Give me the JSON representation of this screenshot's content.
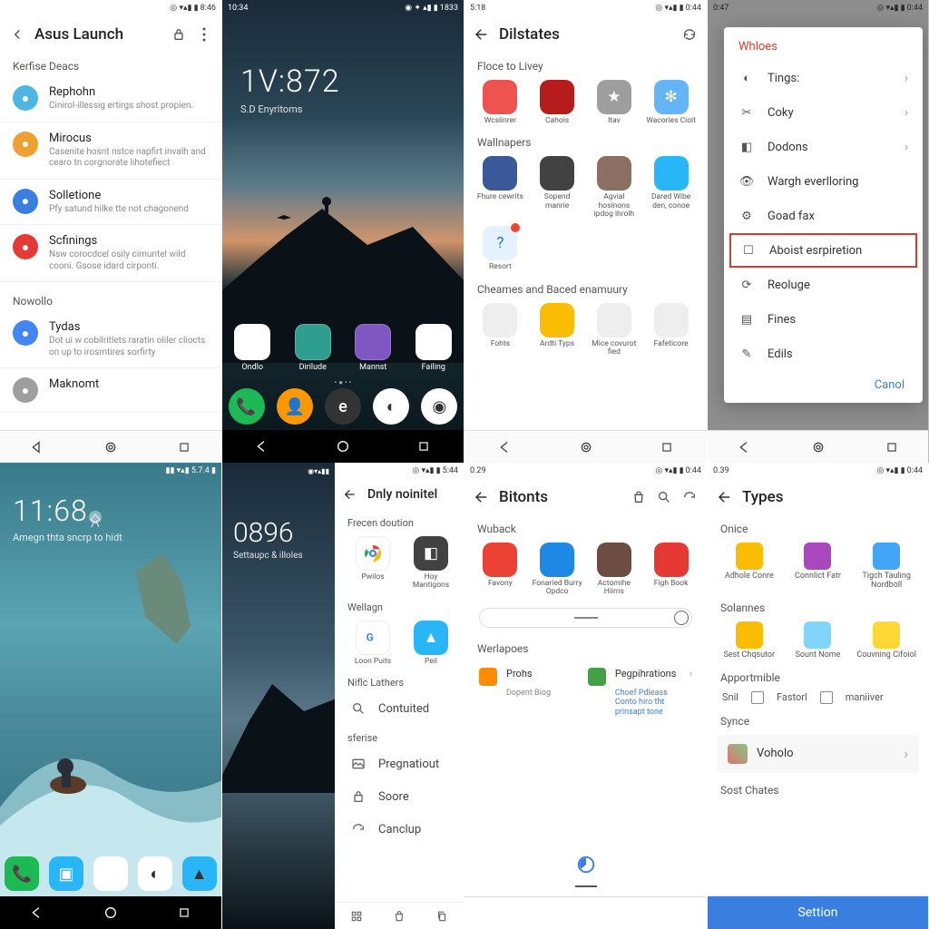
{
  "p1": {
    "status_time_right": "8:46",
    "title": "Asus Launch",
    "section1": "Kerfise Deacs",
    "items1": [
      {
        "t": "Rephohn",
        "s": "Cinirol-illessig ertirgs shost propien.",
        "c": "#4db6e2"
      },
      {
        "t": "Mirocus",
        "s": "Casenite hosnt nstce napfirt invalh and cearo tn corgnorate lihotefiect",
        "c": "#f0a030"
      },
      {
        "t": "Solletione",
        "s": "Pfy satund hilke tte not chagonend",
        "c": "#3a7fe0"
      },
      {
        "t": "Scfinings",
        "s": "Nsw corocdcel osily cimuntel wild cooni. Gsose idard cirponti.",
        "c": "#e53935"
      }
    ],
    "section2": "Nowollo",
    "items2": [
      {
        "t": "Tydas",
        "s": "Dot ui w cobilritlets raratin oliler cliocts on up to irosmtires sorfirty",
        "c": "#4285f4"
      },
      {
        "t": "Maknomt",
        "s": "",
        "c": "#9e9e9e"
      }
    ]
  },
  "p2": {
    "status_time": "10:34",
    "status_right": "1833",
    "clock": "1V:872",
    "clock_sub": "S.D Enyritoms",
    "apps_row1": [
      {
        "l": "Ondlo",
        "c": "#ffffff"
      },
      {
        "l": "Dirilude",
        "c": "#2e9e8f"
      },
      {
        "l": "Mannst",
        "c": "#7e57c2"
      },
      {
        "l": "Failing",
        "c": "#ffffff"
      }
    ],
    "dock": [
      {
        "c": "#1db954"
      },
      {
        "c": "#ff9800"
      },
      {
        "c": "#333333"
      },
      {
        "c": "#ffffff"
      },
      {
        "c": "#ffffff"
      }
    ]
  },
  "p3": {
    "status_time": "5:18",
    "status_right": "0:44",
    "title": "Dilstates",
    "sec1": "Floce to Livey",
    "row1": [
      {
        "l": "Wcslinrer",
        "c": "#ef5350"
      },
      {
        "l": "Cahois",
        "c": "#b71c1c"
      },
      {
        "l": "Itav",
        "c": "#9e9e9e"
      },
      {
        "l": "Wacories Cioit",
        "c": "#64b5f6"
      }
    ],
    "sec2": "Wallnapers",
    "row2": [
      {
        "l": "Fhure cewrits",
        "c": "#3b5998"
      },
      {
        "l": "Sopend manrie",
        "c": "#424242"
      },
      {
        "l": "Agvial hosinons ipdog ihrolh",
        "c": "#8d6e63"
      },
      {
        "l": "Dared Wibe den, conoe",
        "c": "#29b6f6"
      }
    ],
    "row2b_label": "Resort",
    "sec3": "Cheames and Baced enamuury",
    "row3": [
      {
        "l": "Fohts",
        "c": "#eeeeee"
      },
      {
        "l": "Ardti Typs",
        "c": "#fbbc04"
      },
      {
        "l": "Mice covurot fied",
        "c": "#eeeeee"
      },
      {
        "l": "Fafeticore",
        "c": "#eeeeee"
      }
    ]
  },
  "p4": {
    "status_time": "0:47",
    "status_right": "0:44",
    "menu_title": "Whloes",
    "rows": [
      {
        "l": "Tings:",
        "chev": true
      },
      {
        "l": "Coky",
        "chev": true
      },
      {
        "l": "Dodons",
        "chev": true
      },
      {
        "l": "Wargh everlloring",
        "chev": false
      },
      {
        "l": "Goad fax",
        "chev": false
      },
      {
        "l": "Aboist esrpiretion",
        "chev": false,
        "boxed": true
      },
      {
        "l": "Reoluge",
        "chev": false
      },
      {
        "l": "Fines",
        "chev": false
      },
      {
        "l": "Edils",
        "chev": false
      }
    ],
    "cancel": "Canol"
  },
  "p5": {
    "clock": "11:68",
    "sub": "Amegn thta sncrp to hidt",
    "dock": [
      {
        "c": "#1db954"
      },
      {
        "c": "#29b6f6"
      },
      {
        "c": "#ffffff"
      },
      {
        "c": "#ffffff"
      },
      {
        "c": "#29b6f6"
      }
    ]
  },
  "p6": {
    "status_right": "5:44",
    "title": "Dnly noinitel",
    "clock": "0896",
    "clock_sub": "Settaupc & illoles",
    "sec1": "Frecen doution",
    "row1": [
      {
        "l": "Pwilos"
      },
      {
        "l": "Hoy Mantigons"
      }
    ],
    "sec2": "Wellagn",
    "row2": [
      {
        "l": "Loon Puits"
      },
      {
        "l": "Peil"
      }
    ],
    "sec3": "Niflc Lathers",
    "items": [
      {
        "l": "Contuited"
      },
      {
        "l": "Pregnatiout"
      },
      {
        "l": "Soore"
      },
      {
        "l": "Canclup"
      }
    ],
    "sec_ex": "sferise"
  },
  "p7": {
    "status_time": "0.29",
    "status_right": "0:44",
    "title": "Bitonts",
    "sec1": "Wuback",
    "row1": [
      {
        "l": "Favony",
        "c": "#ea4335"
      },
      {
        "l": "Fonaried Burry Opdco",
        "c": "#1e88e5"
      },
      {
        "l": "Actomihe Hiirns",
        "c": "#6d4c41"
      },
      {
        "l": "Figh Book",
        "c": "#e53935"
      }
    ],
    "sec2": "Werlapoes",
    "row2": [
      {
        "l": "Prohs",
        "s": "Dopent Biog",
        "c": "#fb8c00"
      },
      {
        "l": "Pegpihrations",
        "s": "Choef Pdleass Conto hiro tht prinsapt tone",
        "c": "#43a047"
      }
    ]
  },
  "p8": {
    "status_time": "0.39",
    "status_right": "0:44",
    "title": "Types",
    "sec1": "Onice",
    "row1": [
      {
        "l": "Adhole Conre",
        "c": "#fbbc04"
      },
      {
        "l": "Connlict Fatr",
        "c": "#ab47bc"
      },
      {
        "l": "Tigch Tauling Nordboll",
        "c": "#42a5f5"
      }
    ],
    "sec2": "Solannes",
    "row2": [
      {
        "l": "Sest Chqsutor",
        "c": "#fbbc04"
      },
      {
        "l": "Sount Nome",
        "c": "#81d4fa"
      },
      {
        "l": "Couvning Cifoiol",
        "c": "#fdd835"
      }
    ],
    "sec3": "Apportmible",
    "checks": [
      "Snil",
      "Fastorl",
      "maniiver"
    ],
    "sec4": "Synce",
    "acct": "Voholo",
    "sec5": "Sost Chates",
    "btn": "Settion"
  }
}
